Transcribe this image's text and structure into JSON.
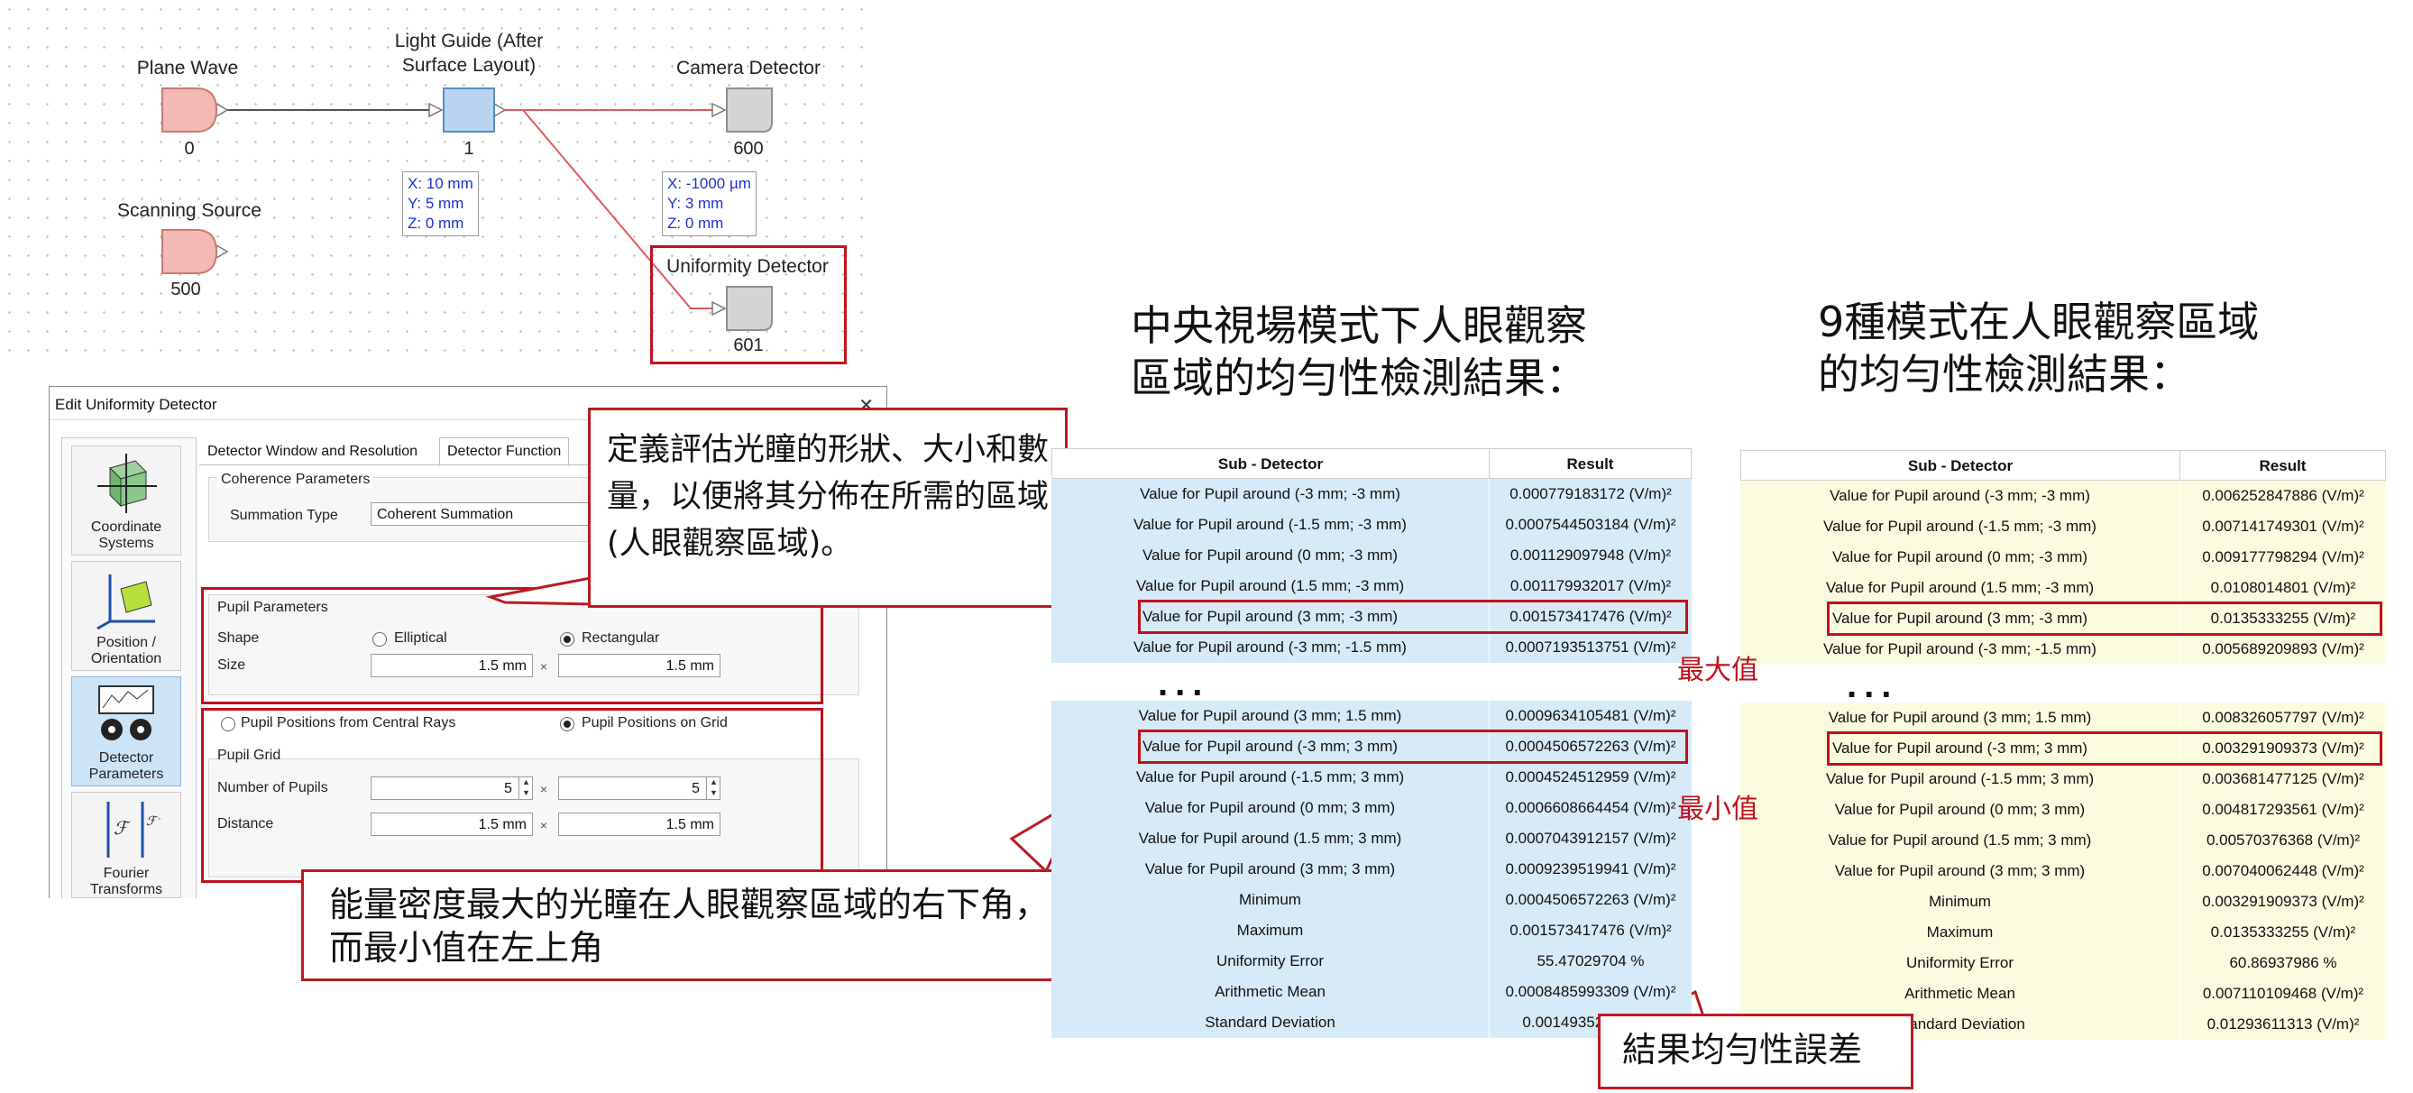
{
  "schematic": {
    "nodes": [
      {
        "label": "Plane Wave",
        "number": "0"
      },
      {
        "label": "Light Guide (After\nSurface Layout)",
        "number": "1"
      },
      {
        "label": "Camera Detector",
        "number": "600"
      },
      {
        "label": "Scanning Source",
        "number": "500"
      },
      {
        "label": "Uniformity Detector",
        "number": "601"
      }
    ],
    "light_guide_coords": [
      "X: 10 mm",
      "Y: 5 mm",
      "Z: 0 mm"
    ],
    "camera_coords": [
      "X: -1000 µm",
      "Y: 3 mm",
      "Z: 0 mm"
    ],
    "colors": {
      "source_fill": "#f3b9b4",
      "guide_fill": "#b9d4f0",
      "detector_fill": "#d4d4d4",
      "link": "#e05a5a",
      "highlight": "#c0121c"
    }
  },
  "dialog": {
    "title": "Edit Uniformity Detector",
    "close": "✕",
    "sidebar": [
      {
        "label": "Coordinate\nSystems",
        "icon": "coordinate-systems-icon"
      },
      {
        "label": "Position /\nOrientation",
        "icon": "position-orientation-icon"
      },
      {
        "label": "Detector\nParameters",
        "icon": "detector-parameters-icon"
      },
      {
        "label": "Fourier\nTransforms",
        "icon": "fourier-transforms-icon"
      }
    ],
    "tabs": [
      "Detector Window and Resolution",
      "Detector Function"
    ],
    "coherence_title": "Coherence Parameters",
    "summation_label": "Summation Type",
    "summation_value": "Coherent Summation",
    "pupil_title": "Pupil Parameters",
    "shape_label": "Shape",
    "shape_options": [
      "Elliptical",
      "Rectangular"
    ],
    "size_label": "Size",
    "size_values": [
      "1.5 mm",
      "1.5 mm"
    ],
    "times": "×",
    "position_options": [
      "Pupil Positions from Central Rays",
      "Pupil Positions on Grid"
    ],
    "grid_title": "Pupil Grid",
    "num_pupils_label": "Number of Pupils",
    "num_pupils_values": [
      "5",
      "5"
    ],
    "distance_label": "Distance",
    "distance_values": [
      "1.5 mm",
      "1.5 mm"
    ]
  },
  "callouts": {
    "pupil_desc": "定義評估光瞳的形狀、大小和數量，以便將其分佈在所需的區域(人眼觀察區域)。",
    "corner_desc": "能量密度最大的光瞳在人眼觀察區域的右下角，而最小值在左上角",
    "error_desc": "結果均勻性誤差"
  },
  "headings": {
    "left": "中央視場模式下人眼觀察\n區域的均勻性檢測結果：",
    "right": "9種模式在人眼觀察區域\n的均勻性檢測結果："
  },
  "labels": {
    "max": "最大值",
    "min": "最小值",
    "ellipsis": "..."
  },
  "table_left": {
    "header": [
      "Sub - Detector",
      "Result"
    ],
    "color": "#d7eaf7",
    "top_rows": [
      [
        "Value for Pupil around (-3 mm; -3 mm)",
        "0.000779183172 (V/m)²"
      ],
      [
        "Value for Pupil around (-1.5 mm; -3 mm)",
        "0.0007544503184 (V/m)²"
      ],
      [
        "Value for Pupil around (0 mm; -3 mm)",
        "0.001129097948 (V/m)²"
      ],
      [
        "Value for Pupil around (1.5 mm; -3 mm)",
        "0.001179932017 (V/m)²"
      ],
      [
        "Value for Pupil around (3 mm; -3 mm)",
        "0.001573417476 (V/m)²"
      ],
      [
        "Value for Pupil around (-3 mm; -1.5 mm)",
        "0.0007193513751 (V/m)²"
      ]
    ],
    "bottom_rows": [
      [
        "Value for Pupil around (3 mm; 1.5 mm)",
        "0.0009634105481 (V/m)²"
      ],
      [
        "Value for Pupil around (-3 mm; 3 mm)",
        "0.0004506572263 (V/m)²"
      ],
      [
        "Value for Pupil around (-1.5 mm; 3 mm)",
        "0.0004524512959 (V/m)²"
      ],
      [
        "Value for Pupil around (0 mm; 3 mm)",
        "0.0006608664454 (V/m)²"
      ],
      [
        "Value for Pupil around (1.5 mm; 3 mm)",
        "0.0007043912157 (V/m)²"
      ],
      [
        "Value for Pupil around (3 mm; 3 mm)",
        "0.0009239519941 (V/m)²"
      ],
      [
        "Minimum",
        "0.0004506572263 (V/m)²"
      ],
      [
        "Maximum",
        "0.001573417476 (V/m)²"
      ],
      [
        "Uniformity Error",
        "55.47029704 %"
      ],
      [
        "Arithmetic Mean",
        "0.0008485993309 (V/m)²"
      ],
      [
        "Standard Deviation",
        "0.001493522 (V/m)²"
      ]
    ]
  },
  "table_right": {
    "header": [
      "Sub - Detector",
      "Result"
    ],
    "color": "#fbfbe0",
    "top_rows": [
      [
        "Value for Pupil around (-3 mm; -3 mm)",
        "0.006252847886 (V/m)²"
      ],
      [
        "Value for Pupil around (-1.5 mm; -3 mm)",
        "0.007141749301 (V/m)²"
      ],
      [
        "Value for Pupil around (0 mm; -3 mm)",
        "0.009177798294 (V/m)²"
      ],
      [
        "Value for Pupil around (1.5 mm; -3 mm)",
        "0.0108014801 (V/m)²"
      ],
      [
        "Value for Pupil around (3 mm; -3 mm)",
        "0.0135333255 (V/m)²"
      ],
      [
        "Value for Pupil around (-3 mm; -1.5 mm)",
        "0.005689209893 (V/m)²"
      ]
    ],
    "bottom_rows": [
      [
        "Value for Pupil around (3 mm; 1.5 mm)",
        "0.008326057797 (V/m)²"
      ],
      [
        "Value for Pupil around (-3 mm; 3 mm)",
        "0.003291909373 (V/m)²"
      ],
      [
        "Value for Pupil around (-1.5 mm; 3 mm)",
        "0.003681477125 (V/m)²"
      ],
      [
        "Value for Pupil around (0 mm; 3 mm)",
        "0.004817293561 (V/m)²"
      ],
      [
        "Value for Pupil around (1.5 mm; 3 mm)",
        "0.00570376368 (V/m)²"
      ],
      [
        "Value for Pupil around (3 mm; 3 mm)",
        "0.007040062448 (V/m)²"
      ],
      [
        "Minimum",
        "0.003291909373 (V/m)²"
      ],
      [
        "Maximum",
        "0.0135333255 (V/m)²"
      ],
      [
        "Uniformity Error",
        "60.86937986 %"
      ],
      [
        "Arithmetic Mean",
        "0.007110109468 (V/m)²"
      ],
      [
        "Standard Deviation",
        "0.01293611313 (V/m)²"
      ]
    ]
  }
}
